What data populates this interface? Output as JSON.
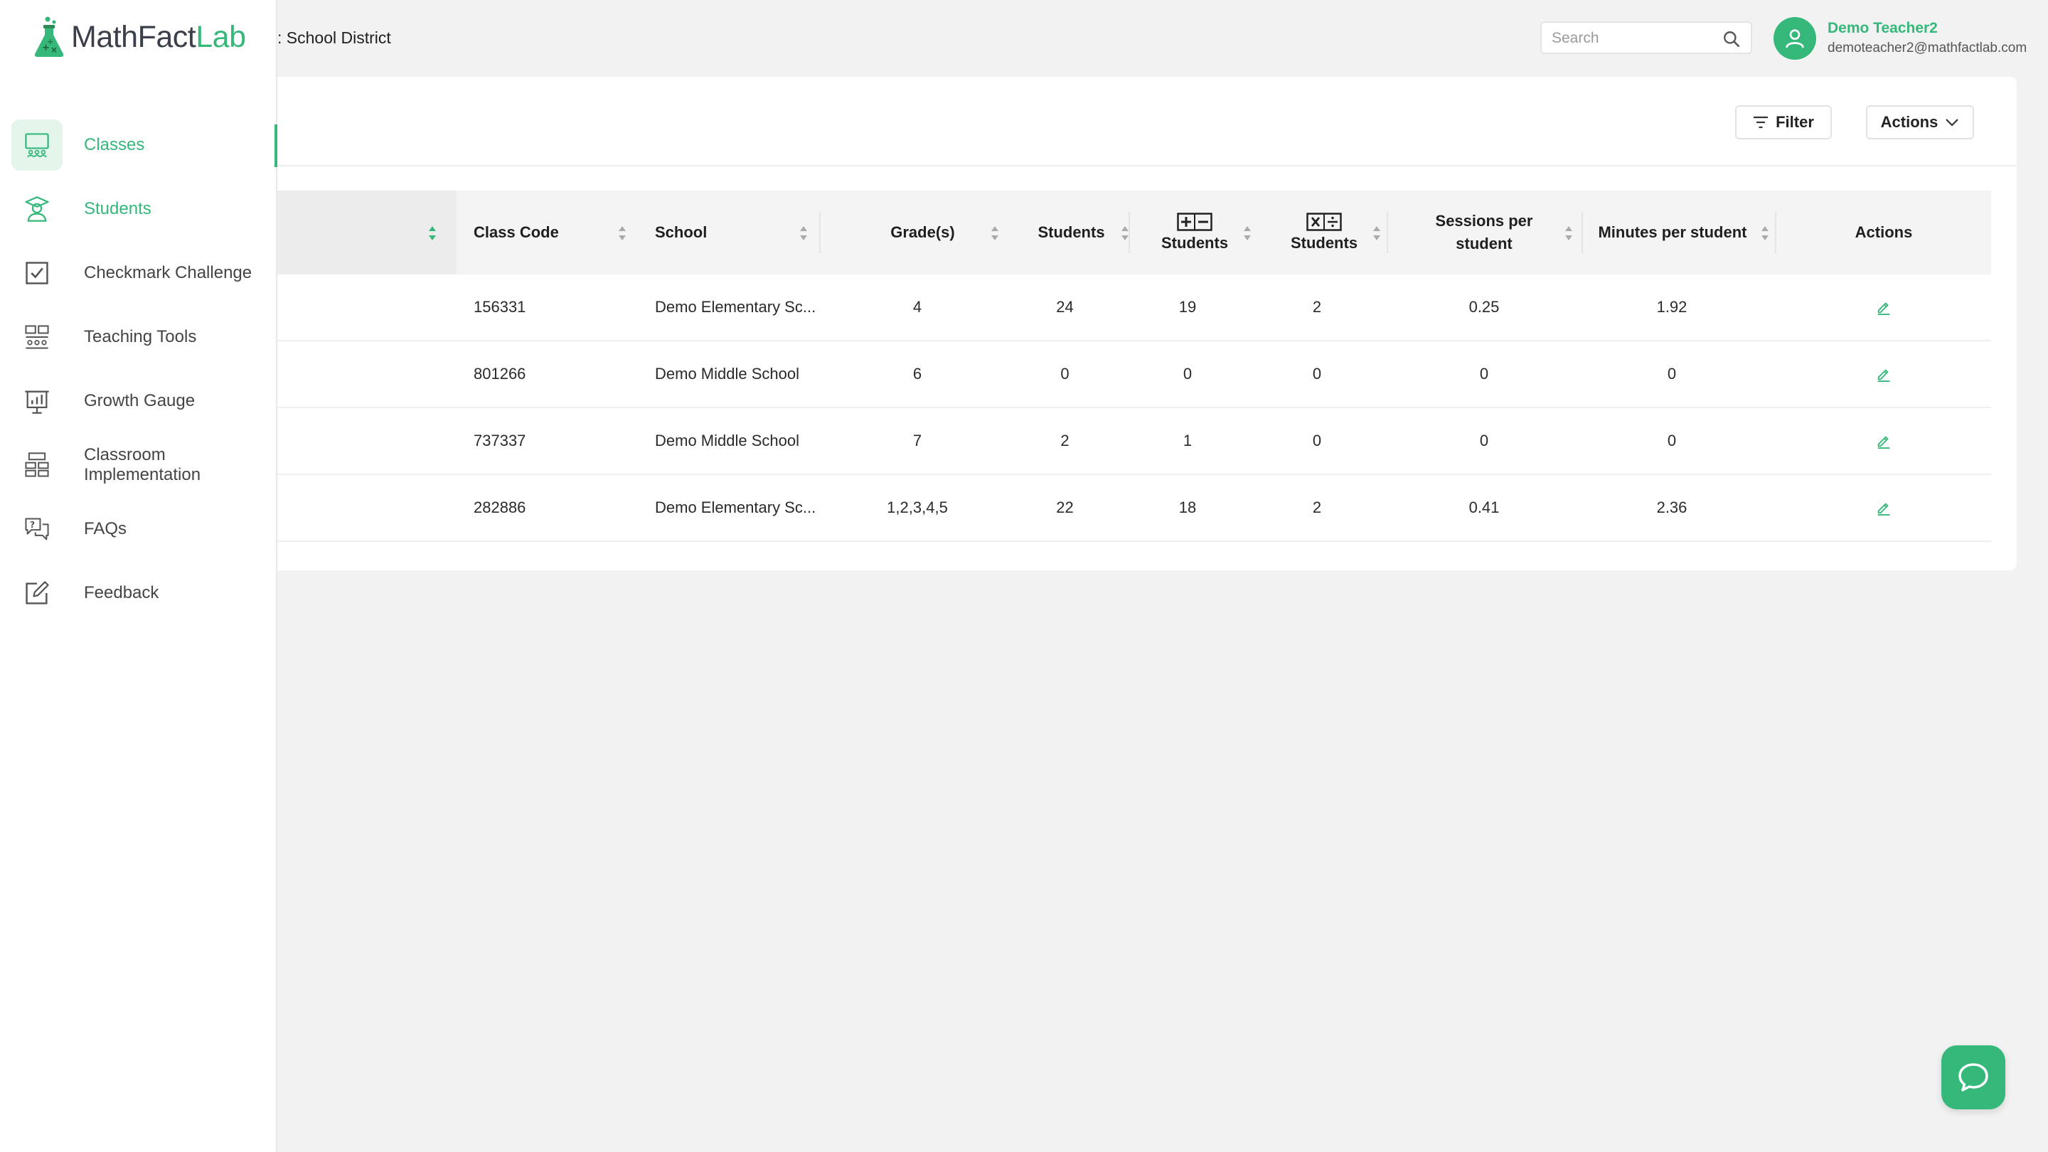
{
  "header": {
    "district": ": School District",
    "search": {
      "placeholder": "Search",
      "value": ""
    },
    "user": {
      "name": "Demo Teacher2",
      "email": "demoteacher2@mathfactlab.com"
    }
  },
  "sidebar": {
    "logo": {
      "part1": "MathFact",
      "part2": "Lab"
    },
    "items": [
      {
        "label": "Classes",
        "icon": "classroom-board-icon",
        "state": "active"
      },
      {
        "label": "Students",
        "icon": "graduate-student-icon",
        "state": "highlight"
      },
      {
        "label": "Checkmark Challenge",
        "icon": "checkbox-icon",
        "state": "normal"
      },
      {
        "label": "Teaching Tools",
        "icon": "teaching-tools-icon",
        "state": "normal"
      },
      {
        "label": "Growth Gauge",
        "icon": "growth-chart-icon",
        "state": "normal"
      },
      {
        "label": "Classroom Implementation",
        "icon": "classroom-desks-icon",
        "state": "normal"
      },
      {
        "label": "FAQs",
        "icon": "faq-chat-icon",
        "state": "normal"
      },
      {
        "label": "Feedback",
        "icon": "feedback-edit-icon",
        "state": "normal"
      }
    ]
  },
  "toolbar": {
    "filter_label": "Filter",
    "actions_label": "Actions"
  },
  "table": {
    "headers": {
      "class_code": "Class Code",
      "school": "School",
      "grades": "Grade(s)",
      "students": "Students",
      "add_sub_students": "Students",
      "mul_div_students": "Students",
      "sessions_line1": "Sessions per",
      "sessions_line2": "student",
      "minutes": "Minutes per student",
      "actions": "Actions"
    },
    "rows": [
      {
        "class_code": "156331",
        "school": "Demo Elementary Sc...",
        "grades": "4",
        "students": "24",
        "add_sub": "19",
        "mul_div": "2",
        "sessions": "0.25",
        "minutes": "1.92"
      },
      {
        "class_code": "801266",
        "school": "Demo Middle School",
        "grades": "6",
        "students": "0",
        "add_sub": "0",
        "mul_div": "0",
        "sessions": "0",
        "minutes": "0"
      },
      {
        "class_code": "737337",
        "school": "Demo Middle School",
        "grades": "7",
        "students": "2",
        "add_sub": "1",
        "mul_div": "0",
        "sessions": "0",
        "minutes": "0"
      },
      {
        "class_code": "282886",
        "school": "Demo Elementary Sc...",
        "grades": "1,2,3,4,5",
        "students": "22",
        "add_sub": "18",
        "mul_div": "2",
        "sessions": "0.41",
        "minutes": "2.36"
      }
    ]
  },
  "colors": {
    "accent": "#35b87a",
    "accent_light": "#e4f5ec",
    "page_bg": "#f2f2f3"
  }
}
